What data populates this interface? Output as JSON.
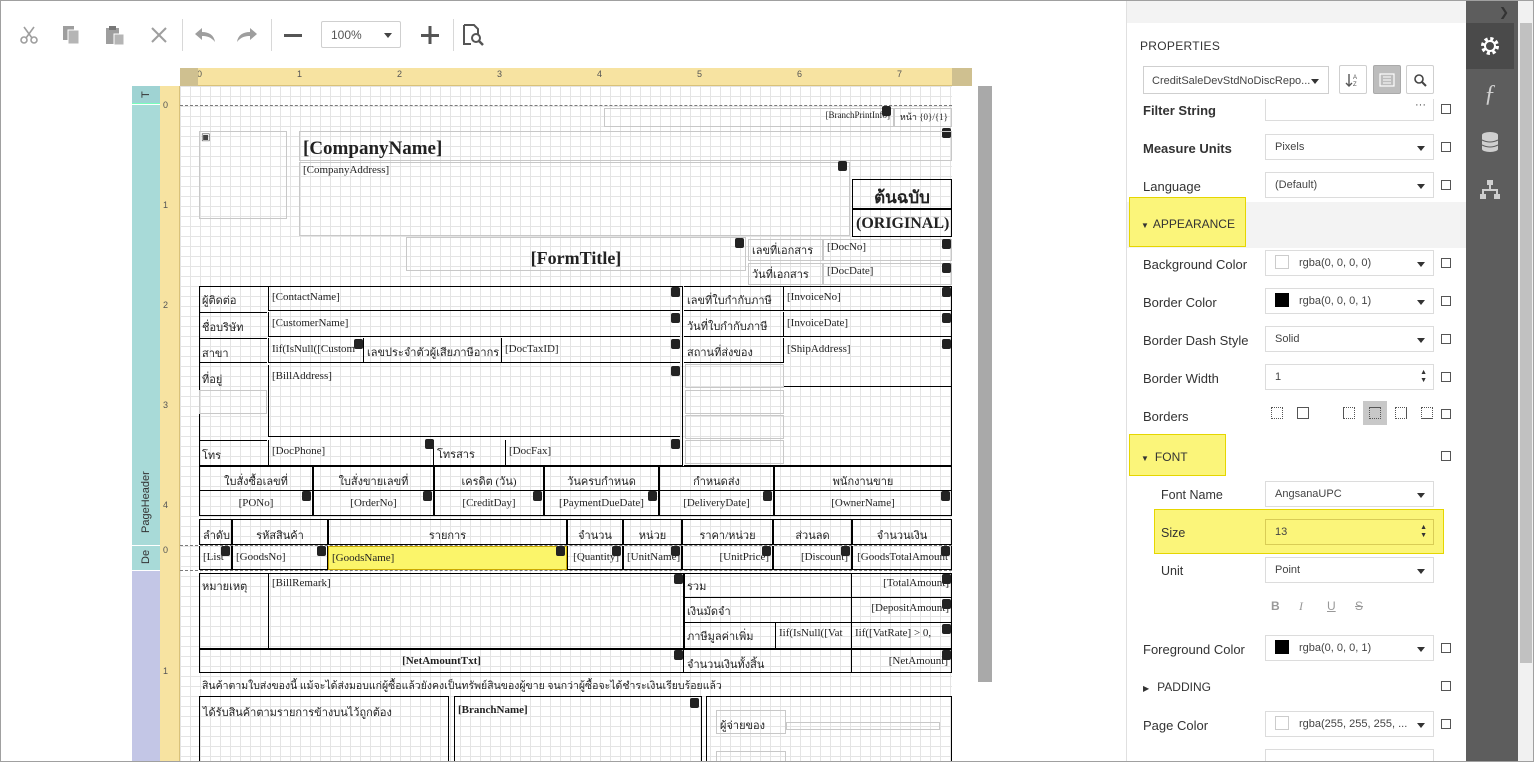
{
  "toolbar": {
    "zoom_value": "100%",
    "icons": [
      "cut-icon",
      "copy-icon",
      "paste-icon",
      "delete-icon",
      "undo-icon",
      "redo-icon",
      "zoom-out-icon",
      "zoom-in-icon",
      "preview-icon"
    ]
  },
  "ruler": {
    "top_ticks": [
      "0",
      "1",
      "2",
      "3",
      "4",
      "5",
      "6",
      "7"
    ],
    "left_ticks_header": [
      "1",
      "2",
      "3",
      "4"
    ],
    "left_ticks_footer": [
      "1"
    ]
  },
  "bands": {
    "top_label": "T",
    "page_header": "PageHeader",
    "detail": "De"
  },
  "report": {
    "branch_print_info": "[BranchPrintInfo]",
    "page_label": "หน้า {0}/{1}",
    "company_name": "[CompanyName]",
    "company_address": "[CompanyAddress]",
    "original_th": "ต้นฉบับ",
    "original_en": "(ORIGINAL)",
    "form_title": "[FormTitle]",
    "doc_no_label": "เลขที่เอกสาร",
    "doc_no": "[DocNo]",
    "doc_date_label": "วันที่เอกสาร",
    "doc_date": "[DocDate]",
    "contact_label": "ผู้ติดต่อ",
    "contact": "[ContactName]",
    "invoice_no_label": "เลขที่ใบกำกับภาษี",
    "invoice_no": "[InvoiceNo]",
    "company_label": "ชื่อบริษัท",
    "customer": "[CustomerName]",
    "invoice_date_label": "วันที่ใบกำกับภาษี",
    "invoice_date": "[InvoiceDate]",
    "branch_label": "สาขา",
    "branch_expr": "Iif(IsNull([Custom",
    "tax_id_label": "เลขประจำตัวผู้เสียภาษีอากร",
    "tax_id": "[DocTaxID]",
    "ship_label": "สถานที่ส่งของ",
    "ship": "[ShipAddress]",
    "address_label": "ที่อยู่",
    "bill_address": "[BillAddress]",
    "phone_label": "โทร",
    "phone": "[DocPhone]",
    "fax_label": "โทรสาร",
    "fax": "[DocFax]",
    "info_headers": [
      "ใบสั่งซื้อเลขที่",
      "ใบสั่งขายเลขที่",
      "เครดิต (วัน)",
      "วันครบกำหนด",
      "กำหนดส่ง",
      "พนักงานขาย"
    ],
    "info_values": [
      "[PONo]",
      "[OrderNo]",
      "[CreditDay]",
      "[PaymentDueDate]",
      "[DeliveryDate]",
      "[OwnerName]"
    ],
    "item_headers": [
      "ลำดับ",
      "รหัสสินค้า",
      "รายการ",
      "จำนวน",
      "หน่วย",
      "ราคา/หน่วย",
      "ส่วนลด",
      "จำนวนเงิน"
    ],
    "item_values": [
      "[List",
      "[GoodsNo]",
      "[GoodsName]",
      "[Quantity]",
      "[UnitName]",
      "[UnitPrice]",
      "[Discount]",
      "[GoodsTotalAmount"
    ],
    "remark_label": "หมายเหตุ",
    "remark": "[BillRemark]",
    "total_label": "รวม",
    "total": "[TotalAmount]",
    "deposit_label": "เงินมัดจำ",
    "deposit": "[DepositAmount]",
    "vat_label": "ภาษีมูลค่าเพิ่ม",
    "vat_expr1": "Iif(IsNull([Vat",
    "vat_expr2": "Iif([VatRate] > 0,",
    "net_txt": "[NetAmountTxt]",
    "net_label": "จำนวนเงินทั้งสิ้น",
    "net": "[NetAmount]",
    "note": "สินค้าตามใบส่งของนี้ แม้จะได้ส่งมอบแก่ผู้ซื้อแล้วยังคงเป็นทรัพย์สินของผู้ขาย จนกว่าผู้ซื้อจะได้ชำระเงินเรียบร้อยแล้ว",
    "received_label": "ได้รับสินค้าตามรายการข้างบนไว้ถูกต้อง",
    "branch_name": "[BranchName]",
    "payer_label": "ผู้จ่ายของ"
  },
  "properties": {
    "title": "PROPERTIES",
    "selected_object": "CreditSaleDevStdNoDiscRepo...",
    "rows": {
      "filter_string": {
        "label": "Filter String",
        "value": ""
      },
      "measure_units": {
        "label": "Measure Units",
        "value": "Pixels"
      },
      "language": {
        "label": "Language",
        "value": "(Default)"
      },
      "appearance": "APPEARANCE",
      "background_color": {
        "label": "Background Color",
        "value": "rgba(0, 0, 0, 0)",
        "swatch": "#ffffff"
      },
      "border_color": {
        "label": "Border Color",
        "value": "rgba(0, 0, 0, 1)",
        "swatch": "#000000"
      },
      "border_dash_style": {
        "label": "Border Dash Style",
        "value": "Solid"
      },
      "border_width": {
        "label": "Border Width",
        "value": "1"
      },
      "borders": {
        "label": "Borders"
      },
      "font": "FONT",
      "font_name": {
        "label": "Font Name",
        "value": "AngsanaUPC"
      },
      "size": {
        "label": "Size",
        "value": "13"
      },
      "unit": {
        "label": "Unit",
        "value": "Point"
      },
      "font_styles": [
        "B",
        "I",
        "U",
        "S"
      ],
      "foreground_color": {
        "label": "Foreground Color",
        "value": "rgba(0, 0, 0, 1)",
        "swatch": "#000000"
      },
      "padding": "PADDING",
      "page_color": {
        "label": "Page Color",
        "value": "rgba(255, 255, 255, ...",
        "swatch": "#ffffff"
      }
    }
  },
  "side_tabs": [
    "settings-icon",
    "expression-icon",
    "data-source-icon",
    "report-explorer-icon"
  ],
  "colors": {
    "highlight": "#fbf57a",
    "side_panel": "#5d5d5d",
    "band_header": "#a8dad8",
    "band_footer": "#c3c6e6",
    "ruler": "#f7e3a1"
  }
}
